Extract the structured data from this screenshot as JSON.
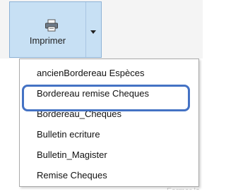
{
  "toolbar": {
    "print_button_label": "Imprimer",
    "print_icon": "printer-icon",
    "dropdown_icon": "chevron-down-icon"
  },
  "menu": {
    "items": [
      {
        "label": "ancienBordereau Espèces"
      },
      {
        "label": "Bordereau remise Cheques"
      },
      {
        "label": "Bordereau_Cheques"
      },
      {
        "label": "Bulletin ecriture"
      },
      {
        "label": "Bulletin_Magister"
      },
      {
        "label": "Remise Cheques"
      }
    ]
  },
  "background": {
    "partial_text": "Fermer la"
  },
  "colors": {
    "button_bg": "#c7e0f4",
    "button_border": "#8db2d6",
    "highlight": "#4472c4"
  }
}
